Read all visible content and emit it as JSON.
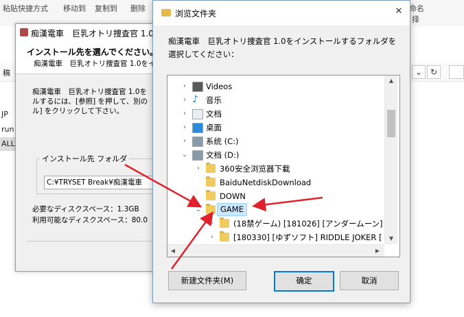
{
  "background": {
    "ribbon_left": "粘贴快捷方式",
    "ribbon_mid1": "移动到",
    "ribbon_mid2": "复制到",
    "ribbon_mid3": "删除",
    "ribbon_right1": "命名",
    "ribbon_right2": "择",
    "addr_left": "稿",
    "sidebar": [
      "JP",
      "run",
      "ALL"
    ],
    "nav_icons": [
      "chevron-down-icon",
      "refresh-icon"
    ]
  },
  "installer": {
    "title": "痴漢電車　巨乳オトリ捜査官 1.0",
    "heading": "インストール先を選んでください。",
    "subheading": "痴漢電車　巨乳オトリ捜査官 1.0をイ",
    "body_lines": [
      "痴漢電車　巨乳オトリ捜査官 1.0を",
      "ルするには、[参照] を押して、別の",
      "ル] をクリックして下さい。"
    ],
    "group_label": "インストール先 フォルダ",
    "path_value": "C:¥TRYSET Break¥痴漢電車",
    "required_space": "必要なディスクスペース：1.3GB",
    "available_space": "利用可能なディスクスペース：80.0"
  },
  "dialog": {
    "title": "浏览文件夹",
    "close_label": "✕",
    "prompt": "痴漢電車　巨乳オトリ捜査官 1.0をインストールするフォルダを選択してください：",
    "tree": [
      {
        "label": "Videos",
        "icon": "videos-icon",
        "expand": "right",
        "indent": 0
      },
      {
        "label": "音乐",
        "icon": "music-icon",
        "expand": "right",
        "indent": 0
      },
      {
        "label": "文档",
        "icon": "document-icon",
        "expand": "right",
        "indent": 0
      },
      {
        "label": "桌面",
        "icon": "desktop-icon",
        "expand": "right",
        "indent": 0
      },
      {
        "label": "系统 (C:)",
        "icon": "drive-icon",
        "expand": "right",
        "indent": 0
      },
      {
        "label": "文档 (D:)",
        "icon": "drive-icon",
        "expand": "down",
        "indent": 0
      },
      {
        "label": "360安全浏览器下載",
        "icon": "folder-icon",
        "expand": "right",
        "indent": 1
      },
      {
        "label": "BaiduNetdiskDownload",
        "icon": "folder-icon",
        "expand": "none",
        "indent": 1
      },
      {
        "label": "DOWN",
        "icon": "folder-icon",
        "expand": "none",
        "indent": 1
      },
      {
        "label": "GAME",
        "icon": "folder-icon",
        "expand": "down",
        "indent": 1,
        "selected": true
      },
      {
        "label": "(18禁ゲーム) [181026] [アンダームーン]",
        "icon": "folder-icon",
        "expand": "right",
        "indent": 2
      },
      {
        "label": "[180330] [ゆずソフト] RIDDLE JOKER [",
        "icon": "folder-icon",
        "expand": "right",
        "indent": 2
      }
    ],
    "new_folder_label": "新建文件夹(M)",
    "ok_label": "确定",
    "cancel_label": "取消",
    "accent": "#0078d7",
    "annotation_color": "#e0212b"
  }
}
